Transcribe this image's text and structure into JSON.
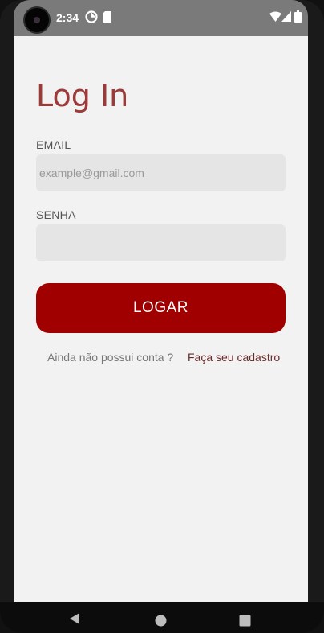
{
  "status_bar": {
    "time": "2:34",
    "icons": [
      "data-saver-icon",
      "sd-card-icon",
      "wifi-icon",
      "signal-icon",
      "battery-icon"
    ]
  },
  "login": {
    "title": "Log In",
    "email_label": "EMAIL",
    "email_placeholder": "example@gmail.com",
    "email_value": "",
    "password_label": "SENHA",
    "password_value": "",
    "submit_label": "LOGAR",
    "signup_prompt": "Ainda não possui conta ?",
    "signup_link": "Faça seu cadastro"
  },
  "nav_bar": {
    "icons": [
      "back-icon",
      "home-icon",
      "recents-icon"
    ]
  },
  "colors": {
    "accent": "#a10000",
    "title": "#9c3a3a",
    "background": "#f2f2f2",
    "input_bg": "#e5e5e5"
  }
}
